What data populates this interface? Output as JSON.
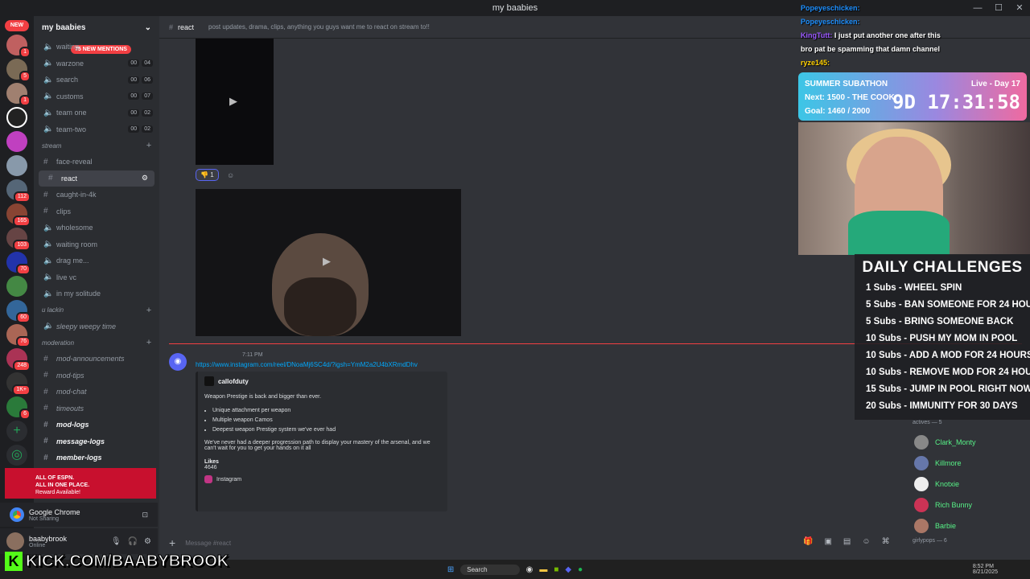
{
  "window": {
    "title": "my baabies"
  },
  "guild_bar": {
    "new_label": "NEW"
  },
  "server": {
    "name": "my baabies",
    "new_mentions": "75 NEW MENTIONS"
  },
  "voice_channels": [
    {
      "name": "waiting",
      "c1": "",
      "c2": ""
    },
    {
      "name": "warzone",
      "c1": "00",
      "c2": "04"
    },
    {
      "name": "search",
      "c1": "00",
      "c2": "06"
    },
    {
      "name": "customs",
      "c1": "00",
      "c2": "07"
    },
    {
      "name": "team one",
      "c1": "00",
      "c2": "02"
    },
    {
      "name": "team-two",
      "c1": "00",
      "c2": "02"
    }
  ],
  "categories": {
    "stream": "stream",
    "ulackin": "u lackin",
    "moderation": "moderation"
  },
  "stream_channels": [
    "face-reveal",
    "react",
    "caught-in-4k",
    "clips",
    "wholesome",
    "waiting room",
    "drag me...",
    "live vc",
    "in my solitude"
  ],
  "ulackin_channels": [
    "sleepy weepy time"
  ],
  "moderation_channels": [
    "mod-announcements",
    "mod-tips",
    "mod-chat",
    "timeouts",
    "mod-logs",
    "message-logs",
    "member-logs"
  ],
  "promo": {
    "line1": "ALL OF ESPN.",
    "line2": "ALL IN ONE PLACE.",
    "line3": "Reward Available!"
  },
  "voice_status": {
    "app": "Google Chrome",
    "status": "Not Sharing"
  },
  "user": {
    "name": "baabybrook",
    "status": "Online"
  },
  "overlay": {
    "kick": "KICK.COM/BAABYBROOK"
  },
  "channel": {
    "name": "react",
    "topic": "post updates, drama, clips, anything you guys want me to react on stream to!!"
  },
  "reaction": {
    "count": "1"
  },
  "message": {
    "time": "7:11 PM",
    "link": "https://www.instagram.com/reel/DNoaMj6SC4d/?igsh=YmM2a2U4bXRmdDhv",
    "embed": {
      "author": "callofduty",
      "intro": "Weapon Prestige is back and bigger than ever.",
      "bullets": [
        "Unique attachment per weapon",
        "Multiple weapon Camos",
        "Deepest weapon Prestige system we've ever had"
      ],
      "body": "We've never had a deeper progression path to display your mastery of the arsenal, and we can't wait for you to get your hands on it all",
      "likes_label": "Likes",
      "likes_value": "4646",
      "footer": "Instagram"
    }
  },
  "composer": {
    "placeholder": "Message #react"
  },
  "stream_chat": [
    {
      "user": "Popeyeschicken:",
      "msg": "",
      "color": "#1e90ff"
    },
    {
      "user": "Popeyeschicken:",
      "msg": "",
      "color": "#1e90ff"
    },
    {
      "user": "KingTutt:",
      "msg": "I just put another one after this",
      "color": "#9b59ff"
    },
    {
      "user": "",
      "msg": "bro pat be spamming that damn channel",
      "color": "#ff3040"
    },
    {
      "user": "ryze145:",
      "msg": "",
      "color": "#ffd000"
    }
  ],
  "subathon": {
    "title": "SUMMER SUBATHON",
    "next": "Next: 1500 - THE COOK",
    "goal": "Goal: 1460 / 2000",
    "live": "Live - Day 17",
    "timer": "9D 17:31:58"
  },
  "challenges": {
    "title": "DAILY CHALLENGES",
    "items": [
      "1 Subs - WHEEL SPIN",
      "5 Subs - BAN SOMEONE FOR 24 HOURS",
      "5 Subs - BRING SOMEONE BACK",
      "10 Subs - PUSH MY MOM IN POOL",
      "10 Subs - ADD A MOD FOR 24 HOURS",
      "10 Subs - REMOVE MOD FOR 24 HOURS",
      "15 Subs - JUMP IN POOL RIGHT NOW",
      "20 Subs - IMMUNITY FOR 30 DAYS"
    ]
  },
  "members": {
    "actives_header": "actives — 5",
    "actives": [
      {
        "name": "Clark_Monty",
        "color": "#57f287"
      },
      {
        "name": "Killmore",
        "color": "#57f287"
      },
      {
        "name": "Knotxie",
        "color": "#57f287"
      },
      {
        "name": "Rich Bunny",
        "color": "#57f287"
      },
      {
        "name": "Barbie",
        "color": "#57f287"
      }
    ],
    "girlypops_header": "girlypops — 6"
  },
  "taskbar": {
    "search": "Search",
    "time": "8:52 PM",
    "date": "8/21/2025"
  }
}
